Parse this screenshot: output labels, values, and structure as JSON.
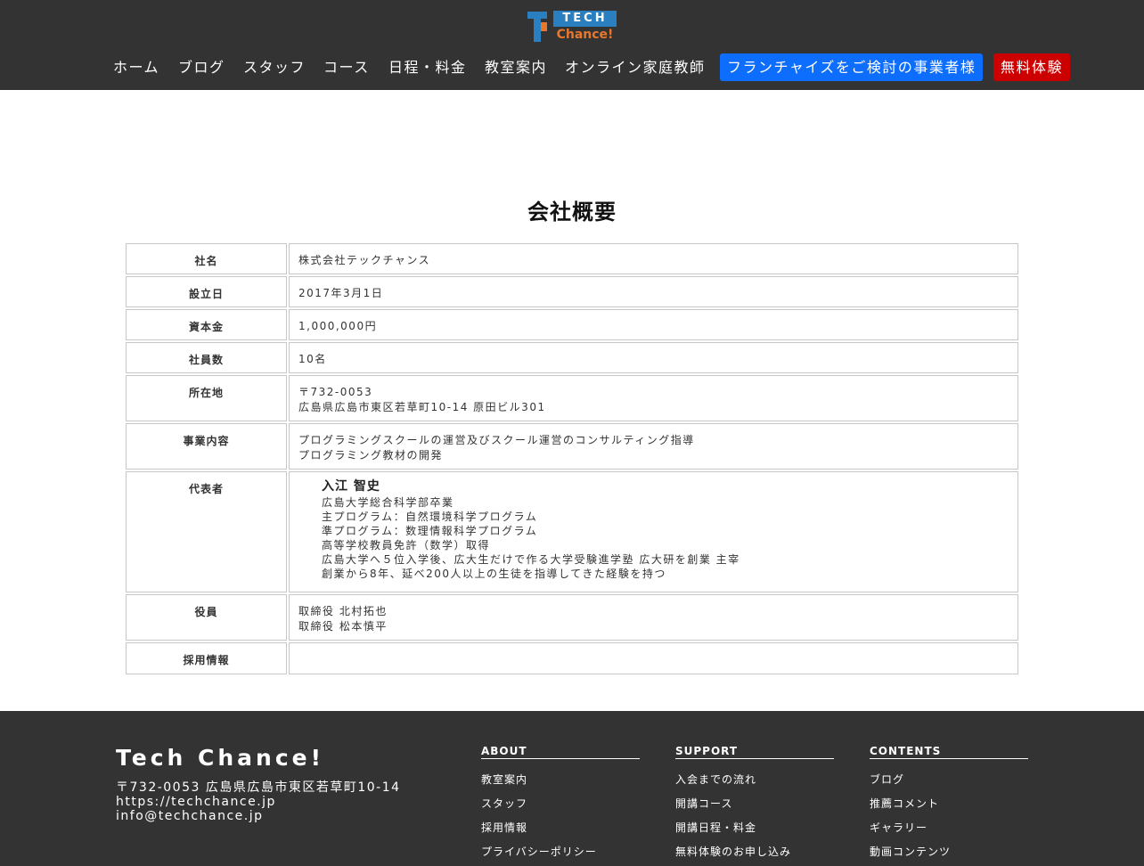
{
  "logo": {
    "top_text": "TECH",
    "bottom_text": "Chance!"
  },
  "nav": {
    "items": [
      "ホーム",
      "ブログ",
      "スタッフ",
      "コース",
      "日程・料金",
      "教室案内",
      "オンライン家庭教師"
    ],
    "franchise_button": "フランチャイズをご検討の事業者様",
    "trial_button": "無料体験"
  },
  "page_title": "会社概要",
  "company_table": {
    "rows": [
      {
        "label": "社名",
        "lines": [
          "株式会社テックチャンス"
        ]
      },
      {
        "label": "設立日",
        "lines": [
          "2017年3月1日"
        ]
      },
      {
        "label": "資本金",
        "lines": [
          "1,000,000円"
        ]
      },
      {
        "label": "社員数",
        "lines": [
          "10名"
        ]
      },
      {
        "label": "所在地",
        "lines": [
          "〒732-0053",
          "広島県広島市東区若草町10-14 原田ビル301"
        ]
      },
      {
        "label": "事業内容",
        "lines": [
          "プログラミングスクールの運営及びスクール運営のコンサルティング指導",
          "プログラミング教材の開発"
        ]
      },
      {
        "label": "代表者",
        "name": "入江 智史",
        "lines": [
          "広島大学総合科学部卒業",
          "主プログラム：自然環境科学プログラム",
          "準プログラム：数理情報科学プログラム",
          "高等学校教員免許（数学）取得",
          "広島大学へ５位入学後、広大生だけで作る大学受験進学塾 広大研を創業 主宰",
          "創業から8年、延べ200人以上の生徒を指導してきた経験を持つ"
        ]
      },
      {
        "label": "役員",
        "lines": [
          "取締役 北村拓也",
          "取締役 松本慎平"
        ]
      },
      {
        "label": "採用情報",
        "lines": [
          ""
        ]
      }
    ]
  },
  "footer": {
    "brand": "Tech Chance!",
    "address": "〒732-0053 広島県広島市東区若草町10-14",
    "url": "https://techchance.jp",
    "email": "info@techchance.jp",
    "columns": [
      {
        "title": "ABOUT",
        "links": [
          "教室案内",
          "スタッフ",
          "採用情報",
          "プライバシーポリシー"
        ]
      },
      {
        "title": "SUPPORT",
        "links": [
          "入会までの流れ",
          "開講コース",
          "開講日程・料金",
          "無料体験のお申し込み"
        ]
      },
      {
        "title": "CONTENTS",
        "links": [
          "ブログ",
          "推薦コメント",
          "ギャラリー",
          "動画コンテンツ"
        ]
      }
    ]
  }
}
